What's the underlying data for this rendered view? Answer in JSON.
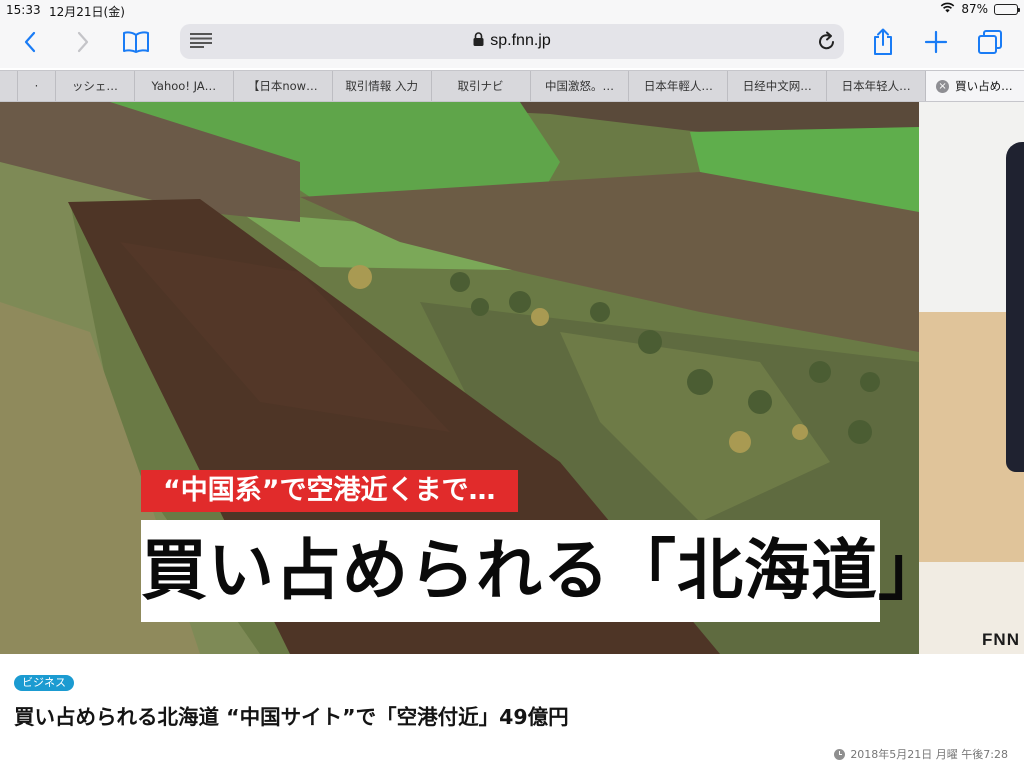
{
  "status_bar": {
    "time": "15:33",
    "date": "12月21日(金)",
    "battery": "87%",
    "battery_level": 0.87
  },
  "toolbar": {
    "url": "sp.fnn.jp",
    "accent_color": "#1a7cf5"
  },
  "tabs": [
    {
      "label": "·"
    },
    {
      "label": "ッシェ…"
    },
    {
      "label": "Yahoo! JA…"
    },
    {
      "label": "【日本now…"
    },
    {
      "label": "取引情報 入力"
    },
    {
      "label": "取引ナビ"
    },
    {
      "label": "中国激怒。…"
    },
    {
      "label": "日本年輕人…"
    },
    {
      "label": "日经中文网…"
    },
    {
      "label": "日本年轻人…"
    },
    {
      "label": "買い占め…",
      "active": true
    }
  ],
  "video": {
    "caption_top": "“中国系”で空港近くまで…",
    "caption_main": "買い占められる「北海道」",
    "logo": "FNN",
    "caption_red_color": "#e12b2b"
  },
  "article": {
    "category": "ビジネス",
    "category_color": "#1b9bd1",
    "headline": "買い占められる北海道 “中国サイト”で「空港付近」49億円",
    "timestamp": "2018年5月21日 月曜 午後7:28"
  }
}
